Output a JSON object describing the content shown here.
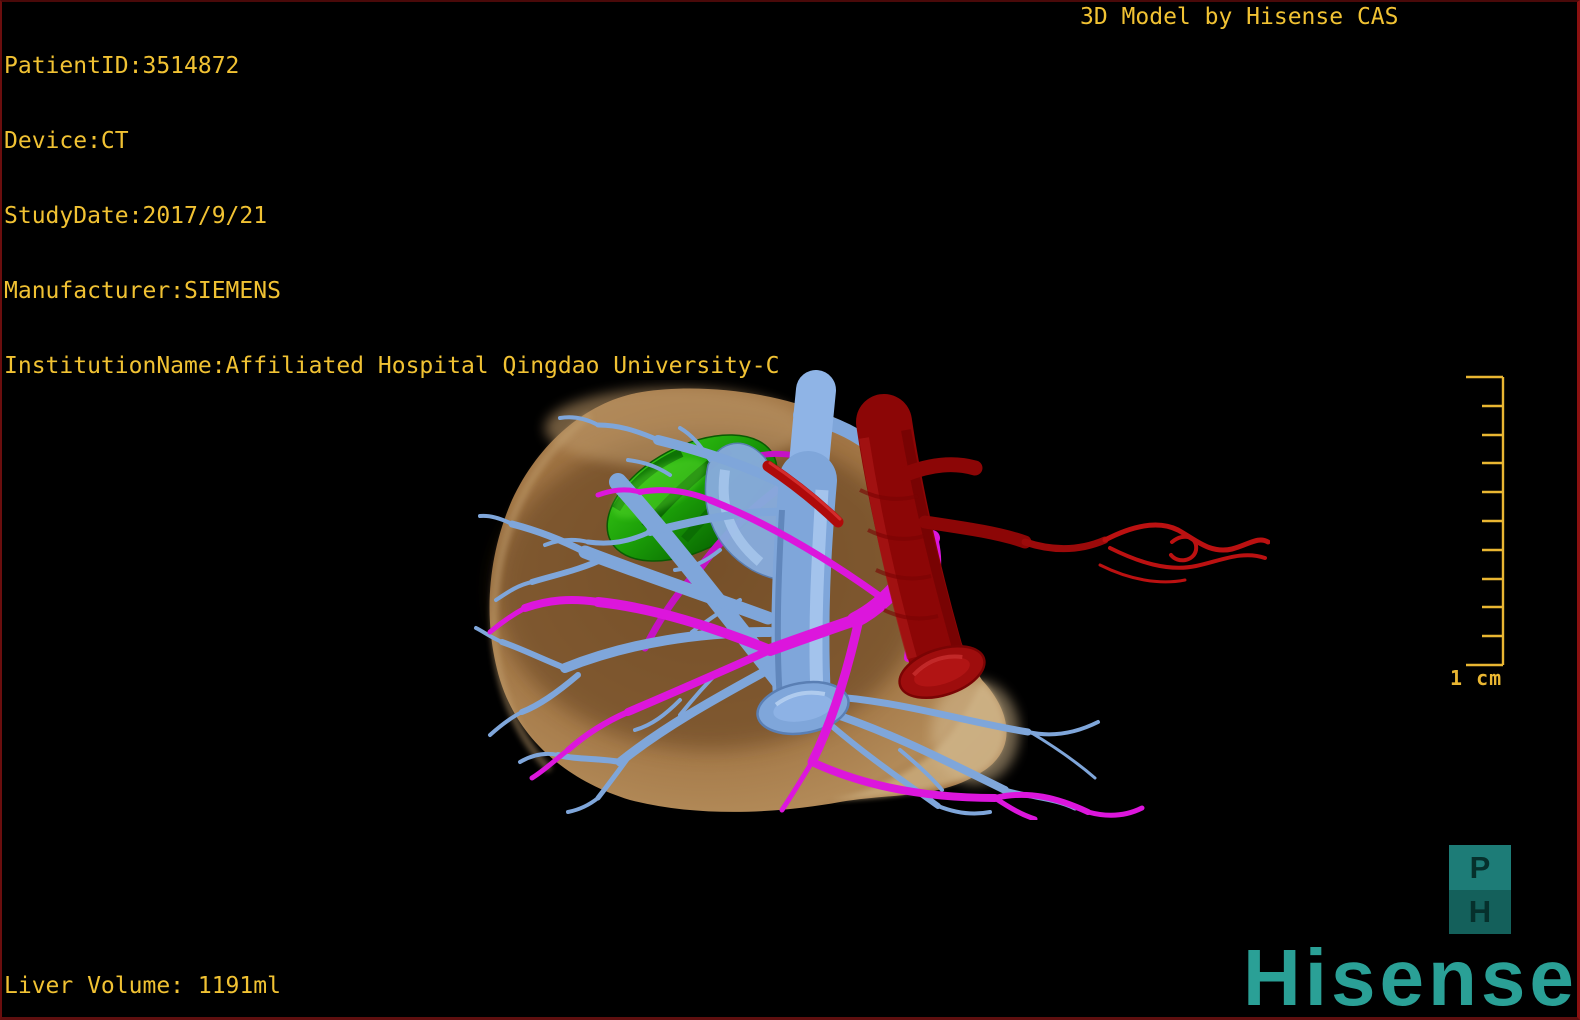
{
  "header": {
    "patient_info_lines": [
      "PatientID:3514872",
      "Device:CT",
      "StudyDate:2017/9/21",
      "Manufacturer:SIEMENS",
      "InstitutionName:Affiliated Hospital Qingdao University-C"
    ],
    "title_right": "3D Model by Hisense CAS"
  },
  "footer": {
    "liver_volume_label": "Liver Volume: 1191ml",
    "liver_volume_ml": 1191
  },
  "scale_bar": {
    "label": "1 cm",
    "tick_count": 11
  },
  "branding": {
    "logo_text": "Hisense",
    "cube_top_letter": "P",
    "cube_bottom_letter": "H"
  },
  "model": {
    "parts": [
      "liver",
      "gallbladder",
      "hepatic-veins",
      "portal-veins",
      "inferior-vena-cava",
      "aorta",
      "hepatic-artery"
    ]
  },
  "colors": {
    "overlay_text": "#F1C233",
    "scale_bar": "#E9B632",
    "brand_teal": "#2AA096",
    "cube_top": "#1D7C77",
    "cube_bottom": "#14605B",
    "border_red": "#6B0E0E",
    "liver": "#A87C4E",
    "liver_rim": "#C9AB7C",
    "gallbladder": "#1FA30C",
    "hepatic_vein": "#7FA6DA",
    "hepatic_vein_light": "#A9C8EE",
    "portal_vein": "#DC16DC",
    "portal_vein_back": "#C512C5",
    "aorta": "#8C0606",
    "artery_bright": "#BB1111"
  }
}
